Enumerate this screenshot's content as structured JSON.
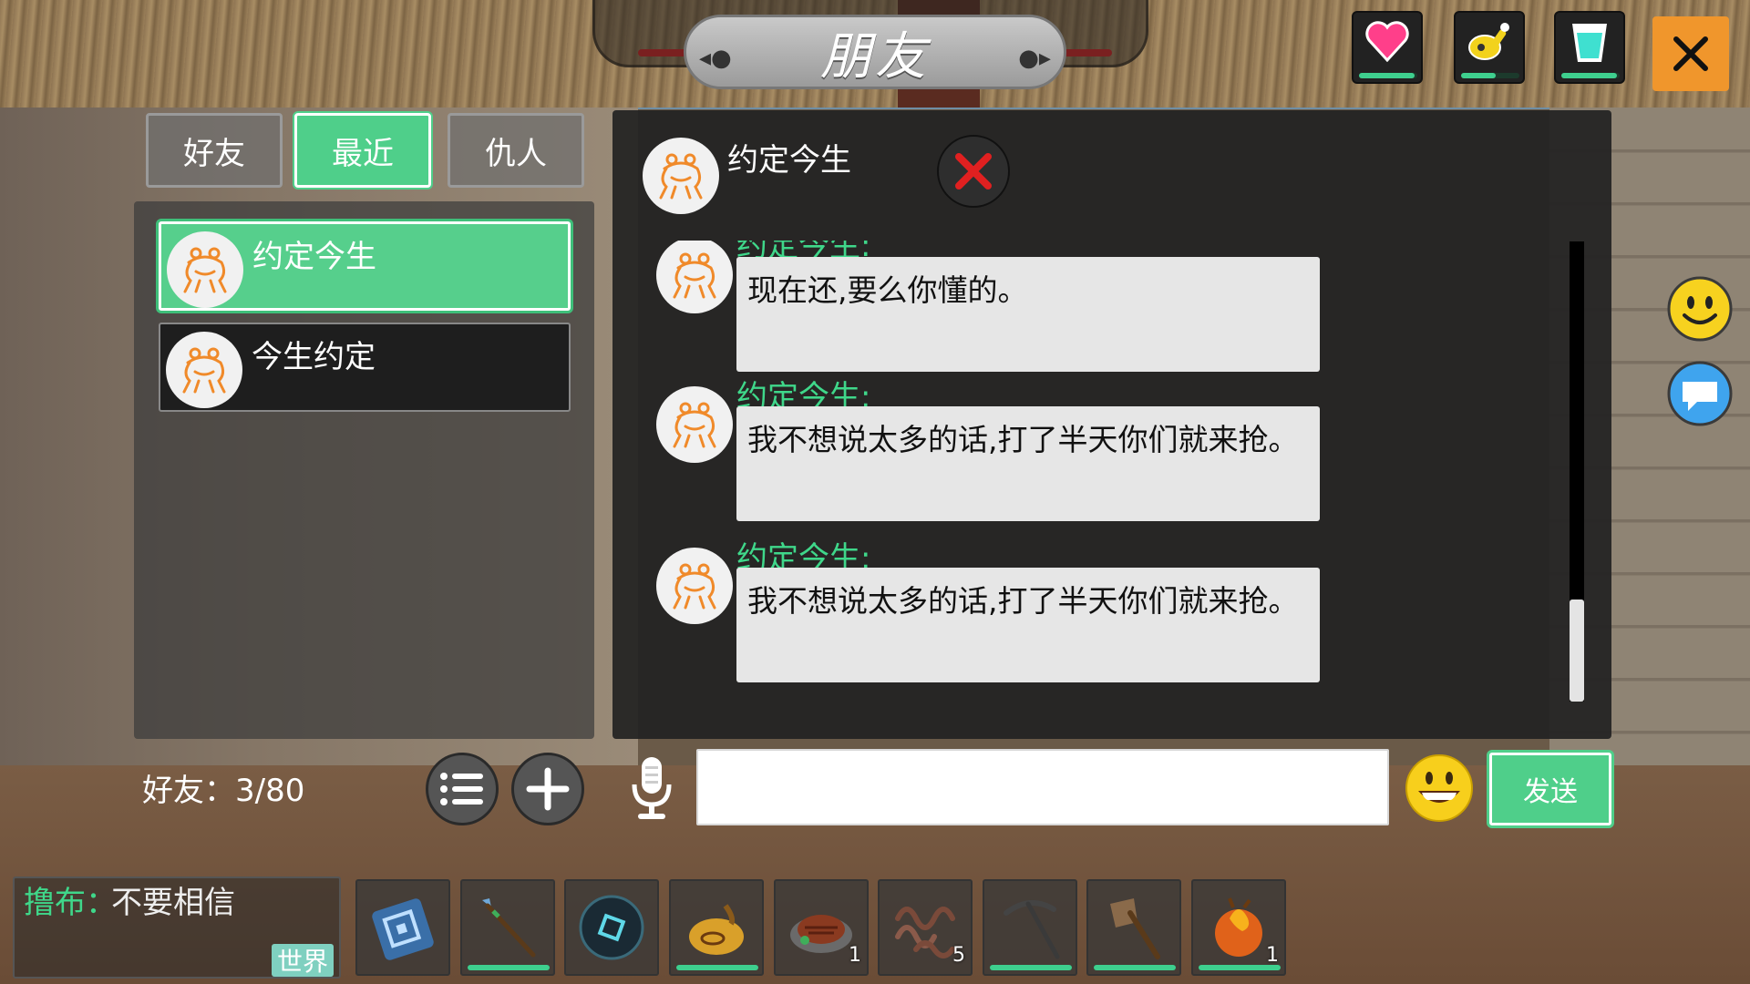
{
  "header": {
    "title": "朋友",
    "stats": [
      {
        "name": "health",
        "icon": "heart-icon",
        "color": "#ff3f8a",
        "level": 0.95
      },
      {
        "name": "hunger",
        "icon": "drumstick-icon",
        "color": "#f2d21c",
        "level": 0.6
      },
      {
        "name": "thirst",
        "icon": "cup-icon",
        "color": "#3fe0d0",
        "level": 0.95
      }
    ],
    "close_icon": "close-icon"
  },
  "tabs": [
    {
      "label": "好友",
      "active": false
    },
    {
      "label": "最近",
      "active": true
    },
    {
      "label": "仇人",
      "active": false
    }
  ],
  "friends": [
    {
      "name": "约定今生",
      "selected": true
    },
    {
      "name": "今生约定",
      "selected": false
    }
  ],
  "friend_count": "好友：3/80",
  "chat": {
    "partner_name": "约定今生",
    "messages": [
      {
        "sender": "约定今生:",
        "text": "现在还,要么你懂的。"
      },
      {
        "sender": "约定今生:",
        "text": "我不想说太多的话,打了半天你们就来抢。"
      },
      {
        "sender": "约定今生:",
        "text": "我不想说太多的话,打了半天你们就来抢。"
      }
    ],
    "input_value": "",
    "send_label": "发送"
  },
  "world_chat": {
    "sender": "撸布：",
    "message": "不要相信",
    "channel": "世界"
  },
  "hotbar": [
    {
      "item": "spellbook-icon",
      "count": "",
      "durability": null
    },
    {
      "item": "spear-icon",
      "count": "",
      "durability": 1.0
    },
    {
      "item": "dark-orb-icon",
      "count": "",
      "durability": null
    },
    {
      "item": "gourd-icon",
      "count": "",
      "durability": 1.0
    },
    {
      "item": "steak-icon",
      "count": "1",
      "durability": null
    },
    {
      "item": "worms-icon",
      "count": "5",
      "durability": null
    },
    {
      "item": "pickaxe-icon",
      "count": "",
      "durability": 1.0
    },
    {
      "item": "axe-icon",
      "count": "",
      "durability": 1.0
    },
    {
      "item": "fire-fruit-icon",
      "count": "1",
      "durability": 1.0
    }
  ],
  "colors": {
    "accent_green": "#4fcf8a",
    "sender_green": "#3fd78a",
    "close_orange": "#f0962c",
    "panel_dark": "#222222"
  }
}
